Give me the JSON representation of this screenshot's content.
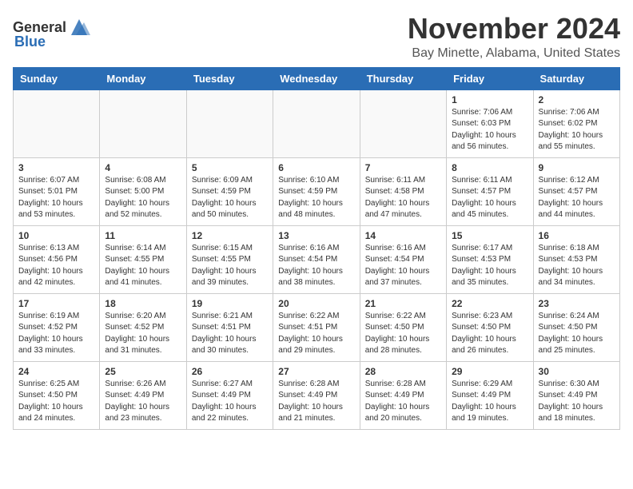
{
  "header": {
    "logo_general": "General",
    "logo_blue": "Blue",
    "month_year": "November 2024",
    "location": "Bay Minette, Alabama, United States"
  },
  "weekdays": [
    "Sunday",
    "Monday",
    "Tuesday",
    "Wednesday",
    "Thursday",
    "Friday",
    "Saturday"
  ],
  "weeks": [
    [
      {
        "day": "",
        "info": ""
      },
      {
        "day": "",
        "info": ""
      },
      {
        "day": "",
        "info": ""
      },
      {
        "day": "",
        "info": ""
      },
      {
        "day": "",
        "info": ""
      },
      {
        "day": "1",
        "info": "Sunrise: 7:06 AM\nSunset: 6:03 PM\nDaylight: 10 hours and 56 minutes."
      },
      {
        "day": "2",
        "info": "Sunrise: 7:06 AM\nSunset: 6:02 PM\nDaylight: 10 hours and 55 minutes."
      }
    ],
    [
      {
        "day": "3",
        "info": "Sunrise: 6:07 AM\nSunset: 5:01 PM\nDaylight: 10 hours and 53 minutes."
      },
      {
        "day": "4",
        "info": "Sunrise: 6:08 AM\nSunset: 5:00 PM\nDaylight: 10 hours and 52 minutes."
      },
      {
        "day": "5",
        "info": "Sunrise: 6:09 AM\nSunset: 4:59 PM\nDaylight: 10 hours and 50 minutes."
      },
      {
        "day": "6",
        "info": "Sunrise: 6:10 AM\nSunset: 4:59 PM\nDaylight: 10 hours and 48 minutes."
      },
      {
        "day": "7",
        "info": "Sunrise: 6:11 AM\nSunset: 4:58 PM\nDaylight: 10 hours and 47 minutes."
      },
      {
        "day": "8",
        "info": "Sunrise: 6:11 AM\nSunset: 4:57 PM\nDaylight: 10 hours and 45 minutes."
      },
      {
        "day": "9",
        "info": "Sunrise: 6:12 AM\nSunset: 4:57 PM\nDaylight: 10 hours and 44 minutes."
      }
    ],
    [
      {
        "day": "10",
        "info": "Sunrise: 6:13 AM\nSunset: 4:56 PM\nDaylight: 10 hours and 42 minutes."
      },
      {
        "day": "11",
        "info": "Sunrise: 6:14 AM\nSunset: 4:55 PM\nDaylight: 10 hours and 41 minutes."
      },
      {
        "day": "12",
        "info": "Sunrise: 6:15 AM\nSunset: 4:55 PM\nDaylight: 10 hours and 39 minutes."
      },
      {
        "day": "13",
        "info": "Sunrise: 6:16 AM\nSunset: 4:54 PM\nDaylight: 10 hours and 38 minutes."
      },
      {
        "day": "14",
        "info": "Sunrise: 6:16 AM\nSunset: 4:54 PM\nDaylight: 10 hours and 37 minutes."
      },
      {
        "day": "15",
        "info": "Sunrise: 6:17 AM\nSunset: 4:53 PM\nDaylight: 10 hours and 35 minutes."
      },
      {
        "day": "16",
        "info": "Sunrise: 6:18 AM\nSunset: 4:53 PM\nDaylight: 10 hours and 34 minutes."
      }
    ],
    [
      {
        "day": "17",
        "info": "Sunrise: 6:19 AM\nSunset: 4:52 PM\nDaylight: 10 hours and 33 minutes."
      },
      {
        "day": "18",
        "info": "Sunrise: 6:20 AM\nSunset: 4:52 PM\nDaylight: 10 hours and 31 minutes."
      },
      {
        "day": "19",
        "info": "Sunrise: 6:21 AM\nSunset: 4:51 PM\nDaylight: 10 hours and 30 minutes."
      },
      {
        "day": "20",
        "info": "Sunrise: 6:22 AM\nSunset: 4:51 PM\nDaylight: 10 hours and 29 minutes."
      },
      {
        "day": "21",
        "info": "Sunrise: 6:22 AM\nSunset: 4:50 PM\nDaylight: 10 hours and 28 minutes."
      },
      {
        "day": "22",
        "info": "Sunrise: 6:23 AM\nSunset: 4:50 PM\nDaylight: 10 hours and 26 minutes."
      },
      {
        "day": "23",
        "info": "Sunrise: 6:24 AM\nSunset: 4:50 PM\nDaylight: 10 hours and 25 minutes."
      }
    ],
    [
      {
        "day": "24",
        "info": "Sunrise: 6:25 AM\nSunset: 4:50 PM\nDaylight: 10 hours and 24 minutes."
      },
      {
        "day": "25",
        "info": "Sunrise: 6:26 AM\nSunset: 4:49 PM\nDaylight: 10 hours and 23 minutes."
      },
      {
        "day": "26",
        "info": "Sunrise: 6:27 AM\nSunset: 4:49 PM\nDaylight: 10 hours and 22 minutes."
      },
      {
        "day": "27",
        "info": "Sunrise: 6:28 AM\nSunset: 4:49 PM\nDaylight: 10 hours and 21 minutes."
      },
      {
        "day": "28",
        "info": "Sunrise: 6:28 AM\nSunset: 4:49 PM\nDaylight: 10 hours and 20 minutes."
      },
      {
        "day": "29",
        "info": "Sunrise: 6:29 AM\nSunset: 4:49 PM\nDaylight: 10 hours and 19 minutes."
      },
      {
        "day": "30",
        "info": "Sunrise: 6:30 AM\nSunset: 4:49 PM\nDaylight: 10 hours and 18 minutes."
      }
    ]
  ]
}
